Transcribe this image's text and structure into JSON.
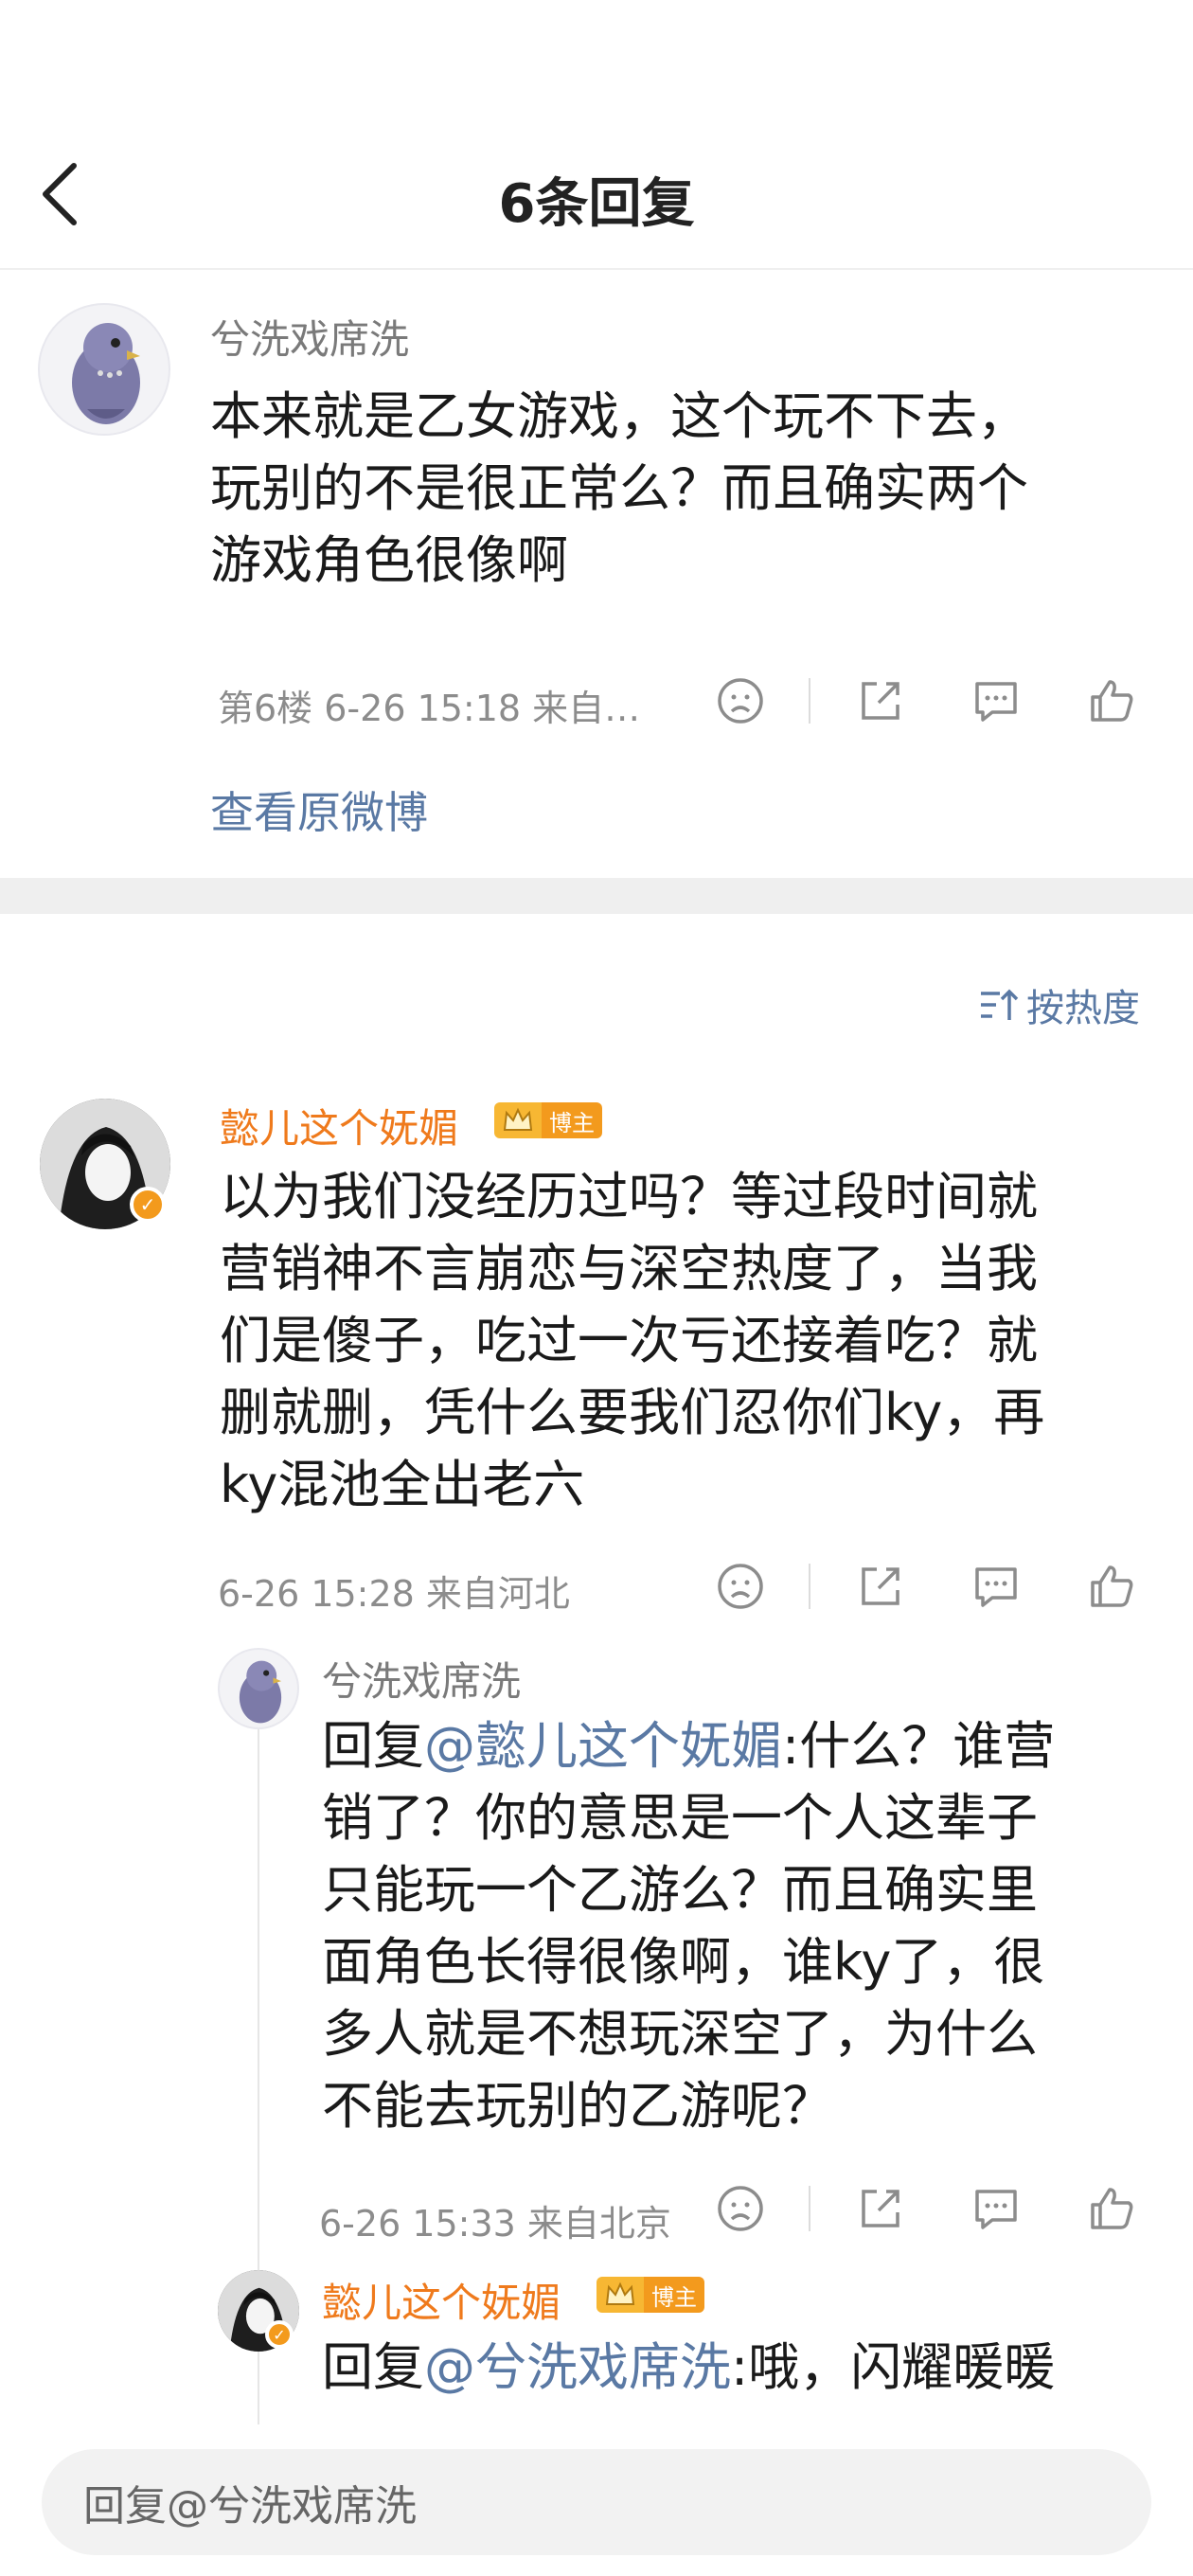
{
  "header": {
    "title": "6条回复"
  },
  "main_post": {
    "author": "兮洗戏席洗",
    "text_lines": [
      "本来就是乙女游戏，这个玩不下去，",
      "玩别的不是很正常么？而且确实两个",
      "游戏角色很像啊"
    ],
    "meta": "第6楼  6-26  15:18  来自…",
    "view_original": "查看原微博"
  },
  "sort": {
    "label": "按热度"
  },
  "comments": [
    {
      "author": "懿儿这个妩媚",
      "badge": "博主",
      "text_lines": [
        "以为我们没经历过吗？等过段时间就",
        "营销神不言崩恋与深空热度了，当我",
        "们是傻子，吃过一次亏还接着吃？就",
        "删就删，凭什么要我们忍你们ky，再",
        "ky混池全出老六"
      ],
      "meta": "6-26  15:28  来自河北"
    }
  ],
  "replies": [
    {
      "author": "兮洗戏席洗",
      "reply_prefix": "回复",
      "mention": "@懿儿这个妩媚",
      "line1_rest": ":什么？谁营",
      "text_lines": [
        "销了？你的意思是一个人这辈子",
        "只能玩一个乙游么？而且确实里",
        "面角色长得很像啊，谁ky了，很",
        "多人就是不想玩深空了，为什么",
        "不能去玩别的乙游呢？"
      ],
      "meta": "6-26  15:33  来自北京"
    },
    {
      "author": "懿儿这个妩媚",
      "badge": "博主",
      "reply_prefix": "回复",
      "mention": "@兮洗戏席洗",
      "line1_rest": ":哦，闪耀暖暖"
    }
  ],
  "bottom": {
    "input_placeholder": "回复@兮洗戏席洗"
  },
  "icons": [
    "back-icon",
    "dislike-icon",
    "share-icon",
    "comment-icon",
    "like-icon",
    "sort-icon",
    "crown-icon",
    "verified-icon"
  ],
  "colors": {
    "accent_blue": "#5a79a4",
    "orange": "#ef7a1c",
    "badge_orange": "#f39a1d",
    "gray_text": "#8c8c8c"
  }
}
